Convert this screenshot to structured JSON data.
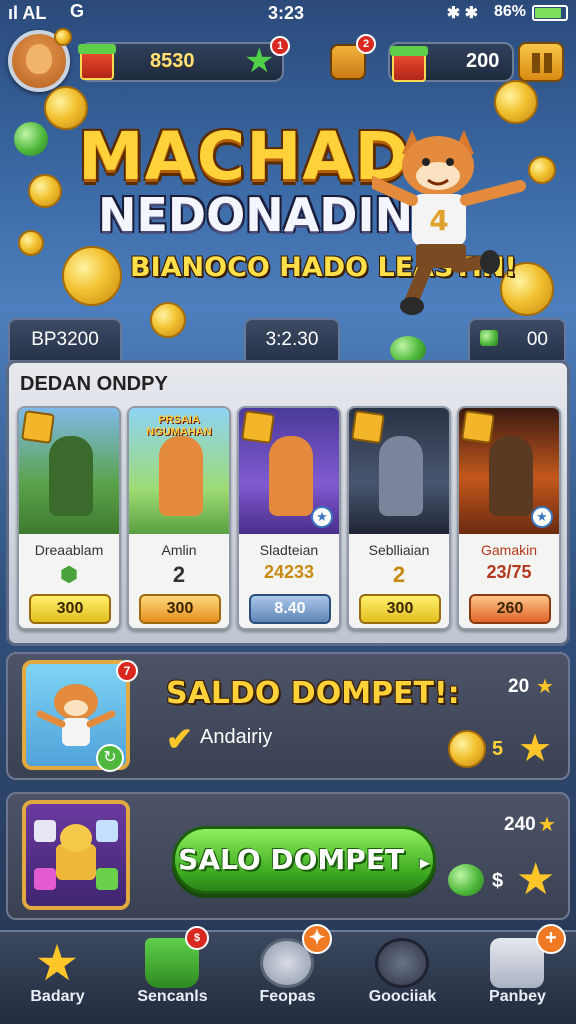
{
  "status_bar": {
    "left": "ıl AL",
    "time": "3:23",
    "right": "86%",
    "battery_level": 0.86
  },
  "top_bar": {
    "coins": "8530",
    "star_badge": "1",
    "gift_badge": "2",
    "gems": "200"
  },
  "hero": {
    "title_line1": "MACHAD",
    "title_line2": "NEDONADIN",
    "subtitle": "BIANOCO HADO LEASTIN!",
    "fox_shirt_number": "4"
  },
  "stats": {
    "left": "BP3200",
    "middle": "3:2.30",
    "right": "00"
  },
  "card_section": {
    "title": "DEDAN ONDPY",
    "cards": [
      {
        "name": "Dreaablam",
        "value": "",
        "price": "300",
        "banner": ""
      },
      {
        "name": "Amlin",
        "value": "2",
        "price": "300",
        "banner": "PRSAIA NGUMAHAN"
      },
      {
        "name": "Sladteian",
        "value": "24233",
        "price": "8.40",
        "banner": ""
      },
      {
        "name": "Seblliaian",
        "value": "2",
        "price": "300",
        "banner": ""
      },
      {
        "name": "Gamakin",
        "value": "23/75",
        "price": "260",
        "banner": ""
      }
    ]
  },
  "reward_row_1": {
    "title": "SALDO DOMPET!:",
    "check_label": "Andairiy",
    "star_count": "20",
    "coin_count": "5",
    "badge": "7"
  },
  "reward_row_2": {
    "button_label": "SALO DOMPET",
    "star_count": "240",
    "gem_label": "$"
  },
  "bottom_nav": {
    "items": [
      {
        "label": "Badary"
      },
      {
        "label": "Sencanls"
      },
      {
        "label": "Feopas"
      },
      {
        "label": "Goociiak"
      },
      {
        "label": "Panbey"
      }
    ]
  },
  "colors": {
    "gold": "#ffd23a",
    "green": "#3eaa22",
    "panel": "#e7e9ee",
    "badge_red": "#d9281f"
  }
}
